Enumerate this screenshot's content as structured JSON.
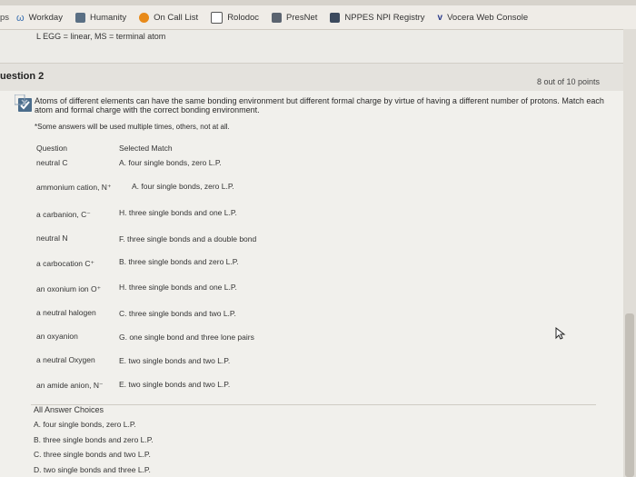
{
  "bookmarks": [
    {
      "label": "ps",
      "icon": "cut-icon"
    },
    {
      "label": "Workday",
      "icon": "workday-icon"
    },
    {
      "label": "Humanity",
      "icon": "humanity-icon"
    },
    {
      "label": "On Call List",
      "icon": "on-call-icon"
    },
    {
      "label": "Rolodoc",
      "icon": "rolodoc-icon"
    },
    {
      "label": "PresNet",
      "icon": "presnet-icon"
    },
    {
      "label": "NPPES NPI Registry",
      "icon": "nppes-icon"
    },
    {
      "label": "Vocera Web Console",
      "icon": "vocera-icon"
    }
  ],
  "previous": {
    "text": "L EGG = linear, MS = terminal atom"
  },
  "question": {
    "title": "uestion 2",
    "points": "8 out of 10 points",
    "text": "Atoms of different elements can have the same bonding environment but different formal charge by virtue of having a different number of protons. Match each atom and formal charge with the correct bonding environment.",
    "note": "*Some answers will be used multiple times, others, not at all.",
    "col_question": "Question",
    "col_selected": "Selected Match",
    "rows": [
      {
        "q": "neutral C",
        "a": "A. four single bonds, zero L.P."
      },
      {
        "q": "ammonium cation, N⁺",
        "a": "A. four single bonds, zero L.P."
      },
      {
        "q": "a carbanion, C⁻",
        "a": "H. three single bonds and one L.P."
      },
      {
        "q": "neutral N",
        "a": "F. three single bonds and a double bond"
      },
      {
        "q": "a carbocation C⁺",
        "a": "B. three single bonds and zero L.P."
      },
      {
        "q": "an oxonium ion O⁺",
        "a": "H. three single bonds and one L.P."
      },
      {
        "q": "a neutral halogen",
        "a": "C. three single bonds and two L.P."
      },
      {
        "q": "an oxyanion",
        "a": "G. one single bond and three lone pairs"
      },
      {
        "q": "a neutral Oxygen",
        "a": "E. two single bonds and two L.P."
      },
      {
        "q": "an amide anion, N⁻",
        "a": "E. two single bonds and two L.P."
      }
    ],
    "choices_header": "All Answer Choices",
    "choices": [
      "A. four single bonds, zero L.P.",
      "B. three single bonds and zero L.P.",
      "C. three single bonds and two L.P.",
      "D. two single bonds and three L.P."
    ]
  }
}
